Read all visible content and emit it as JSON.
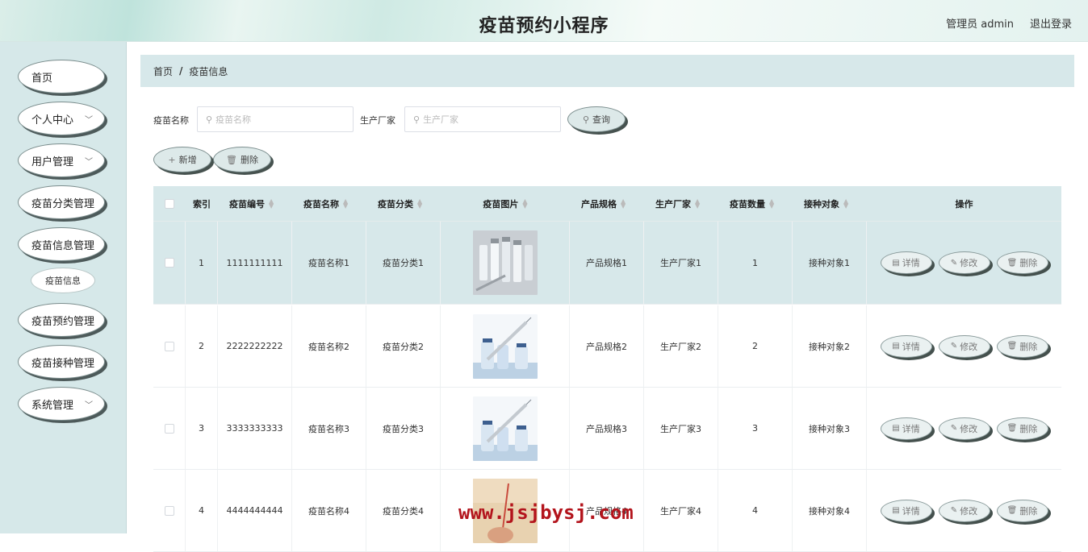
{
  "header": {
    "title": "疫苗预约小程序",
    "user_label": "管理员 admin",
    "logout_label": "退出登录"
  },
  "sidebar": {
    "items": [
      {
        "label": "首页"
      },
      {
        "label": "个人中心"
      },
      {
        "label": "用户管理"
      },
      {
        "label": "疫苗分类管理"
      },
      {
        "label": "疫苗信息管理"
      },
      {
        "label": "疫苗预约管理"
      },
      {
        "label": "疫苗接种管理"
      },
      {
        "label": "系统管理"
      }
    ],
    "sub_item": "疫苗信息"
  },
  "breadcrumb": {
    "home": "首页",
    "separator": "/",
    "current": "疫苗信息"
  },
  "search": {
    "name_label": "疫苗名称",
    "name_placeholder": "疫苗名称",
    "maker_label": "生产厂家",
    "maker_placeholder": "生产厂家",
    "query_label": "查询"
  },
  "toolbar": {
    "add_label": "新增",
    "delete_label": "删除"
  },
  "table": {
    "headers": [
      "索引",
      "疫苗编号",
      "疫苗名称",
      "疫苗分类",
      "疫苗图片",
      "产品规格",
      "生产厂家",
      "疫苗数量",
      "接种对象",
      "操作"
    ],
    "rows": [
      {
        "index": "1",
        "code": "1111111111",
        "name": "疫苗名称1",
        "category": "疫苗分类1",
        "spec": "产品规格1",
        "maker": "生产厂家1",
        "qty": "1",
        "target": "接种对象1"
      },
      {
        "index": "2",
        "code": "2222222222",
        "name": "疫苗名称2",
        "category": "疫苗分类2",
        "spec": "产品规格2",
        "maker": "生产厂家2",
        "qty": "2",
        "target": "接种对象2"
      },
      {
        "index": "3",
        "code": "3333333333",
        "name": "疫苗名称3",
        "category": "疫苗分类3",
        "spec": "产品规格3",
        "maker": "生产厂家3",
        "qty": "3",
        "target": "接种对象3"
      },
      {
        "index": "4",
        "code": "4444444444",
        "name": "疫苗名称4",
        "category": "疫苗分类4",
        "spec": "产品规格4",
        "maker": "生产厂家4",
        "qty": "4",
        "target": "接种对象4"
      }
    ],
    "ops": {
      "detail": "详情",
      "edit": "修改",
      "delete": "删除"
    }
  },
  "watermark": "www.jsjbysj.com"
}
